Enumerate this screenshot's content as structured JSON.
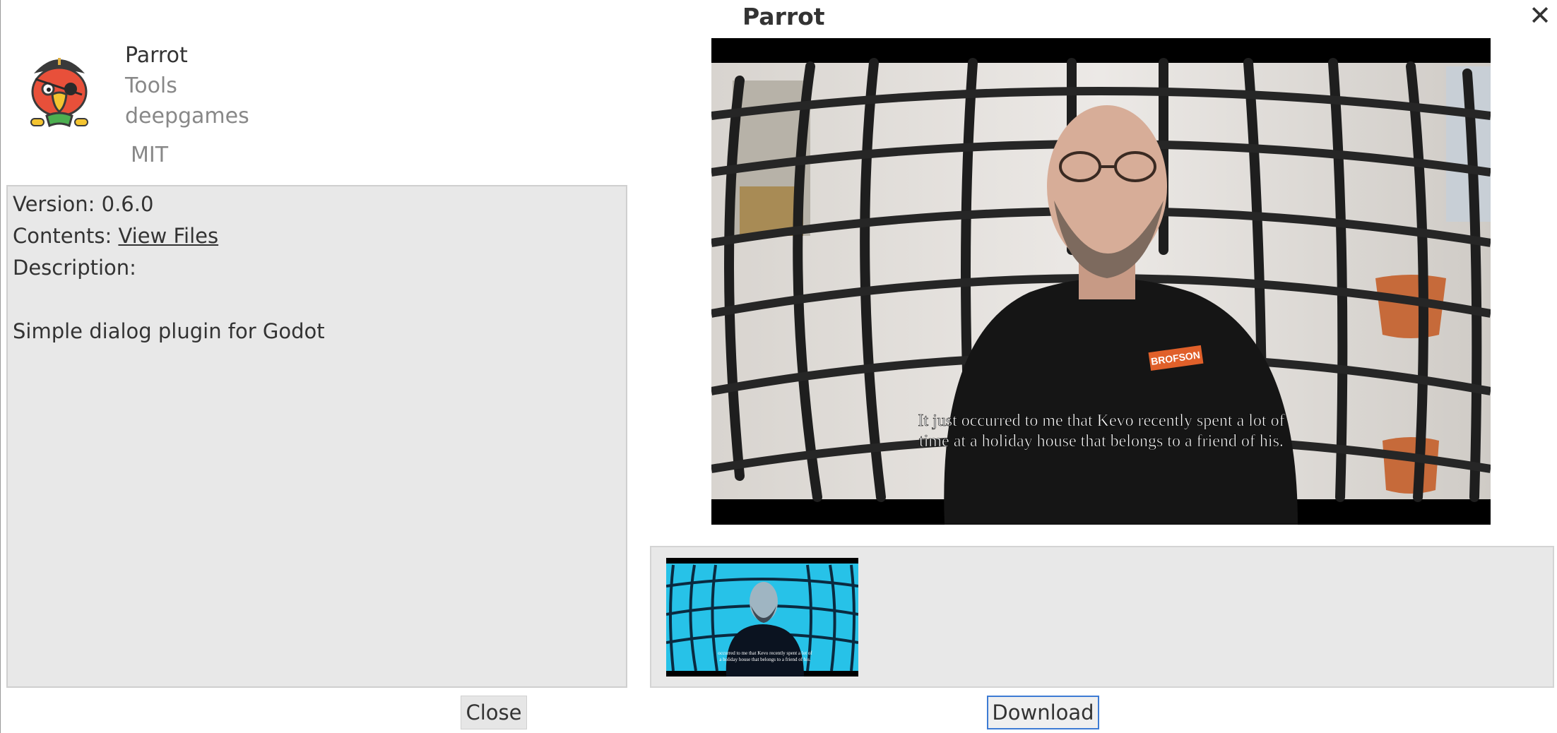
{
  "dialog": {
    "title": "Parrot",
    "close_icon": "close-icon"
  },
  "asset": {
    "icon": "parrot-pirate-icon",
    "name": "Parrot",
    "category": "Tools",
    "author": "deepgames",
    "license": "MIT"
  },
  "details": {
    "version_label": "Version: 0.6.0",
    "contents_label": "Contents: ",
    "contents_link": "View Files",
    "description_label": "Description:",
    "description_text": "Simple dialog plugin for Godot"
  },
  "preview": {
    "subtitle_line1": "It just occurred to me that Kevo recently spent a lot of",
    "subtitle_line2": "time at a holiday house that belongs to a friend of his.",
    "shirt_logo": "BROFSON"
  },
  "thumbnail": {
    "subtitle_line1": "occurred to me that Kevo recently spent a lot of",
    "subtitle_line2": "a holiday house that belongs to a friend of his."
  },
  "buttons": {
    "close": "Close",
    "download": "Download"
  }
}
